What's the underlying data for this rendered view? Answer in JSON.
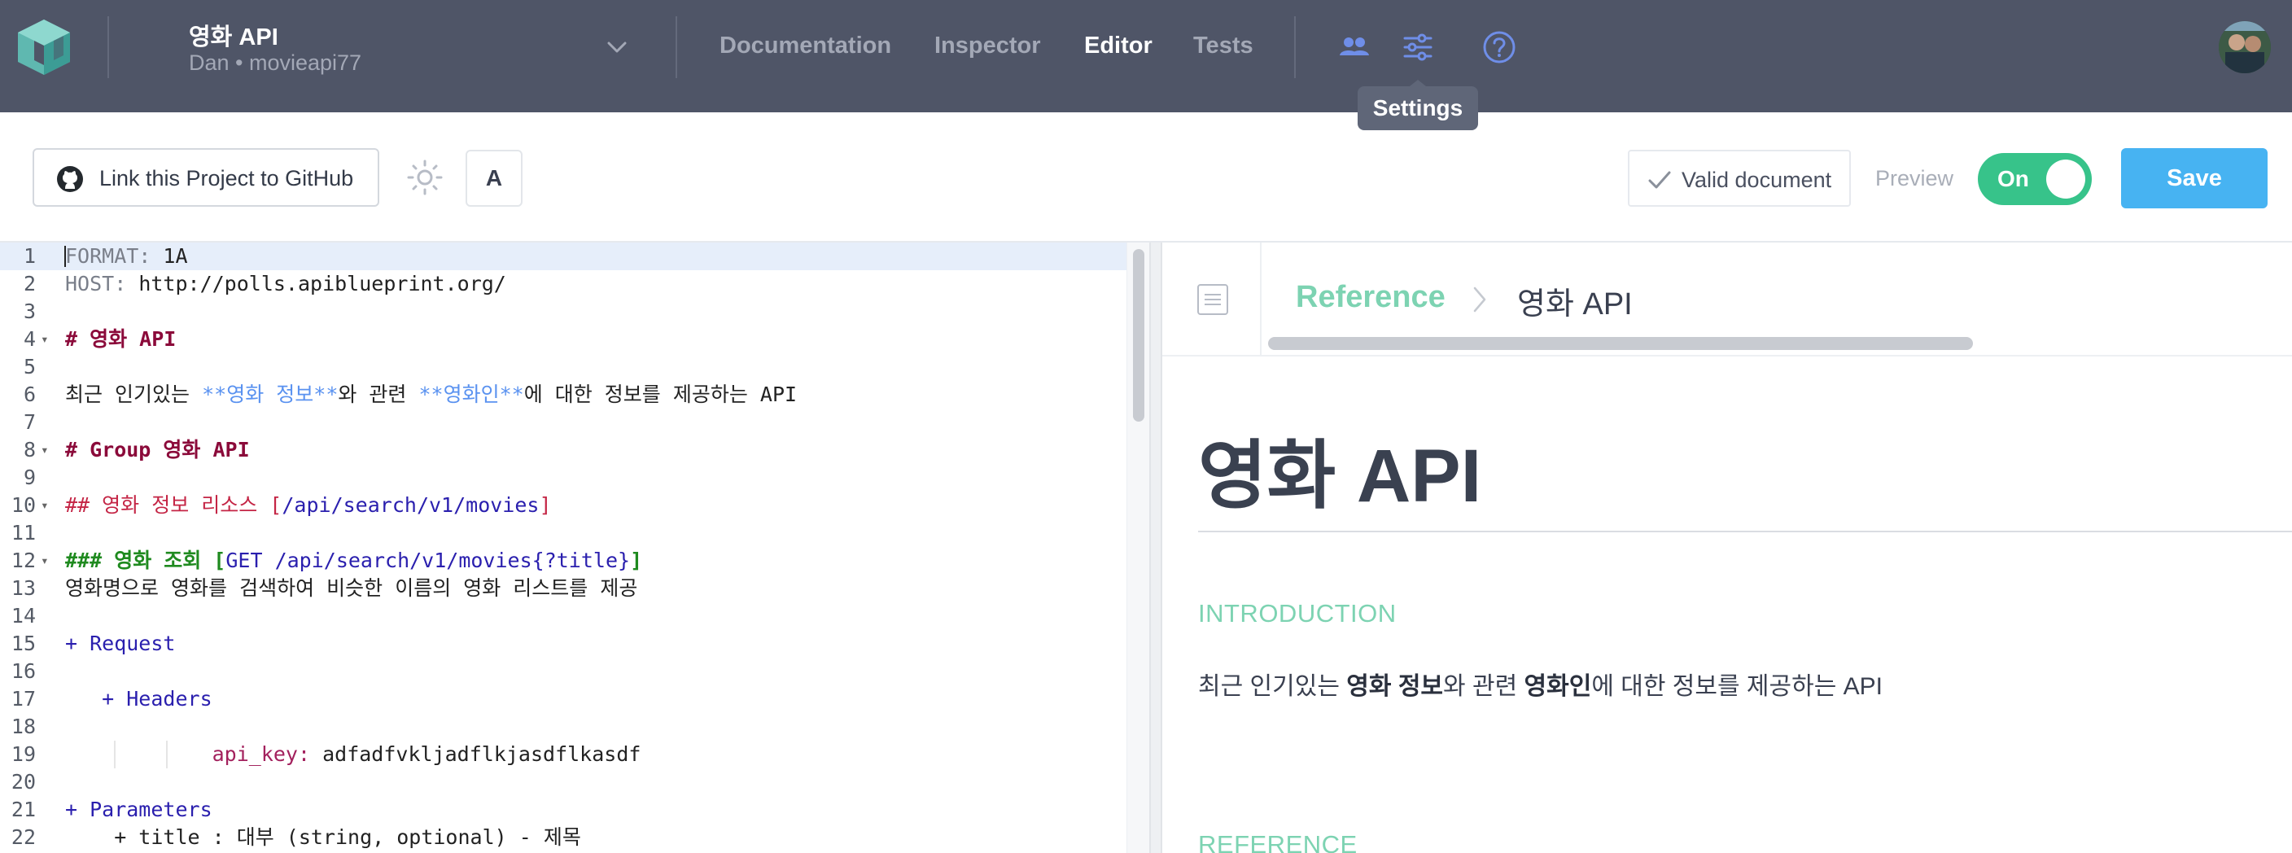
{
  "header": {
    "project_name": "영화 API",
    "project_owner": "Dan • movieapi77",
    "tabs": [
      {
        "label": "Documentation",
        "active": false
      },
      {
        "label": "Inspector",
        "active": false
      },
      {
        "label": "Editor",
        "active": true
      },
      {
        "label": "Tests",
        "active": false
      }
    ],
    "icons": [
      "team-icon",
      "settings-icon",
      "help-icon"
    ],
    "tooltip": "Settings"
  },
  "toolbar": {
    "github_label": "Link this Project to GitHub",
    "font_button": "A",
    "valid_label": "Valid document",
    "preview_label": "Preview",
    "toggle_label": "On",
    "save_label": "Save"
  },
  "editor": {
    "lines": [
      {
        "n": "1",
        "fold": false,
        "tokens": [
          {
            "c": "c-meta",
            "t": "FORMAT: "
          },
          {
            "c": "c-plain",
            "t": "1A"
          }
        ]
      },
      {
        "n": "2",
        "fold": false,
        "tokens": [
          {
            "c": "c-meta",
            "t": "HOST: "
          },
          {
            "c": "c-plain",
            "t": "http://polls.apiblueprint.org/"
          }
        ]
      },
      {
        "n": "3",
        "fold": false,
        "tokens": []
      },
      {
        "n": "4",
        "fold": true,
        "tokens": [
          {
            "c": "c-h1",
            "t": "# 영화 API"
          }
        ]
      },
      {
        "n": "5",
        "fold": false,
        "tokens": []
      },
      {
        "n": "6",
        "fold": false,
        "tokens": [
          {
            "c": "c-plain",
            "t": "최근 인기있는 "
          },
          {
            "c": "c-blue",
            "t": "**영화 정보**"
          },
          {
            "c": "c-plain",
            "t": "와 관련 "
          },
          {
            "c": "c-blue",
            "t": "**영화인**"
          },
          {
            "c": "c-plain",
            "t": "에 대한 정보를 제공하는 API"
          }
        ]
      },
      {
        "n": "7",
        "fold": false,
        "tokens": []
      },
      {
        "n": "8",
        "fold": true,
        "tokens": [
          {
            "c": "c-h1",
            "t": "# Group 영화 API"
          }
        ]
      },
      {
        "n": "9",
        "fold": false,
        "tokens": []
      },
      {
        "n": "10",
        "fold": true,
        "tokens": [
          {
            "c": "c-h2",
            "t": "## 영화 정보 리소스 ["
          },
          {
            "c": "c-url",
            "t": "/api/search/v1/movies"
          },
          {
            "c": "c-h2",
            "t": "]"
          }
        ]
      },
      {
        "n": "11",
        "fold": false,
        "tokens": []
      },
      {
        "n": "12",
        "fold": true,
        "tokens": [
          {
            "c": "c-h3",
            "t": "### 영화 조회 ["
          },
          {
            "c": "c-url",
            "t": "GET /api/search/v1/movies{?title}"
          },
          {
            "c": "c-h3",
            "t": "]"
          }
        ]
      },
      {
        "n": "13",
        "fold": false,
        "tokens": [
          {
            "c": "c-plain",
            "t": "영화명으로 영화를 검색하여 비슷한 이름의 영화 리스트를 제공"
          }
        ]
      },
      {
        "n": "14",
        "fold": false,
        "tokens": []
      },
      {
        "n": "15",
        "fold": false,
        "tokens": [
          {
            "c": "c-req",
            "t": "+ Request"
          }
        ]
      },
      {
        "n": "16",
        "fold": false,
        "tokens": []
      },
      {
        "n": "17",
        "fold": false,
        "tokens": [
          {
            "c": "c-plain",
            "t": "   "
          },
          {
            "c": "c-req",
            "t": "+ Headers"
          }
        ]
      },
      {
        "n": "18",
        "fold": false,
        "tokens": []
      },
      {
        "n": "19",
        "fold": false,
        "tokens": [
          {
            "c": "c-plain",
            "t": "            "
          },
          {
            "c": "c-key",
            "t": "api_key: "
          },
          {
            "c": "c-plain",
            "t": "adfadfvkljadflkjasdflkasdf"
          }
        ]
      },
      {
        "n": "20",
        "fold": false,
        "tokens": []
      },
      {
        "n": "21",
        "fold": false,
        "tokens": [
          {
            "c": "c-req",
            "t": "+ Parameters"
          }
        ]
      },
      {
        "n": "22",
        "fold": false,
        "tokens": [
          {
            "c": "c-plain",
            "t": "    + title : 대부 (string, optional) - 제목"
          }
        ]
      }
    ]
  },
  "preview": {
    "breadcrumb_root": "Reference",
    "breadcrumb_current": "영화 API",
    "title": "영화 API",
    "section_intro": "INTRODUCTION",
    "intro_parts": [
      {
        "bold": false,
        "t": "최근 인기있는 "
      },
      {
        "bold": true,
        "t": "영화 정보"
      },
      {
        "bold": false,
        "t": "와 관련 "
      },
      {
        "bold": true,
        "t": "영화인"
      },
      {
        "bold": false,
        "t": "에 대한 정보를 제공하는 API"
      }
    ],
    "section_reference": "REFERENCE"
  },
  "colors": {
    "topbar": "#4f5567",
    "accent_green": "#37c38a",
    "save_blue": "#47b3f2",
    "reference_green": "#7dd3b2",
    "icon_blue": "#6f8ee8"
  }
}
